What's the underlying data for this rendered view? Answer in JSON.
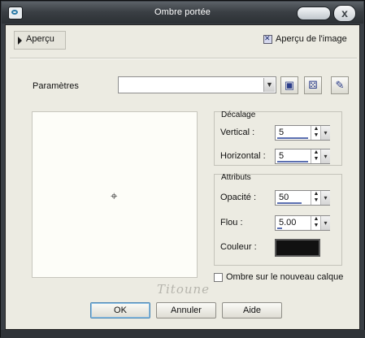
{
  "window": {
    "title": "Ombre portée",
    "close_glyph": "x"
  },
  "preview": {
    "toggle_label": "Aperçu",
    "image_preview_label": "Aperçu de l'image",
    "image_preview_checked": true
  },
  "params": {
    "label": "Paramètres",
    "value": "",
    "icons": [
      "save-icon",
      "dice-icon",
      "reset-icon"
    ]
  },
  "decalage": {
    "legend": "Décalage",
    "vertical_label": "Vertical :",
    "vertical_value": "5",
    "horizontal_label": "Horizontal :",
    "horizontal_value": "5"
  },
  "attributs": {
    "legend": "Attributs",
    "opacite_label": "Opacité :",
    "opacite_value": "50",
    "flou_label": "Flou :",
    "flou_value": "5.00",
    "couleur_label": "Couleur :",
    "couleur": "#111111"
  },
  "new_layer": {
    "label": "Ombre sur le nouveau calque",
    "checked": false
  },
  "signature": "Titoune",
  "buttons": {
    "ok": "OK",
    "cancel": "Annuler",
    "help": "Aide"
  }
}
